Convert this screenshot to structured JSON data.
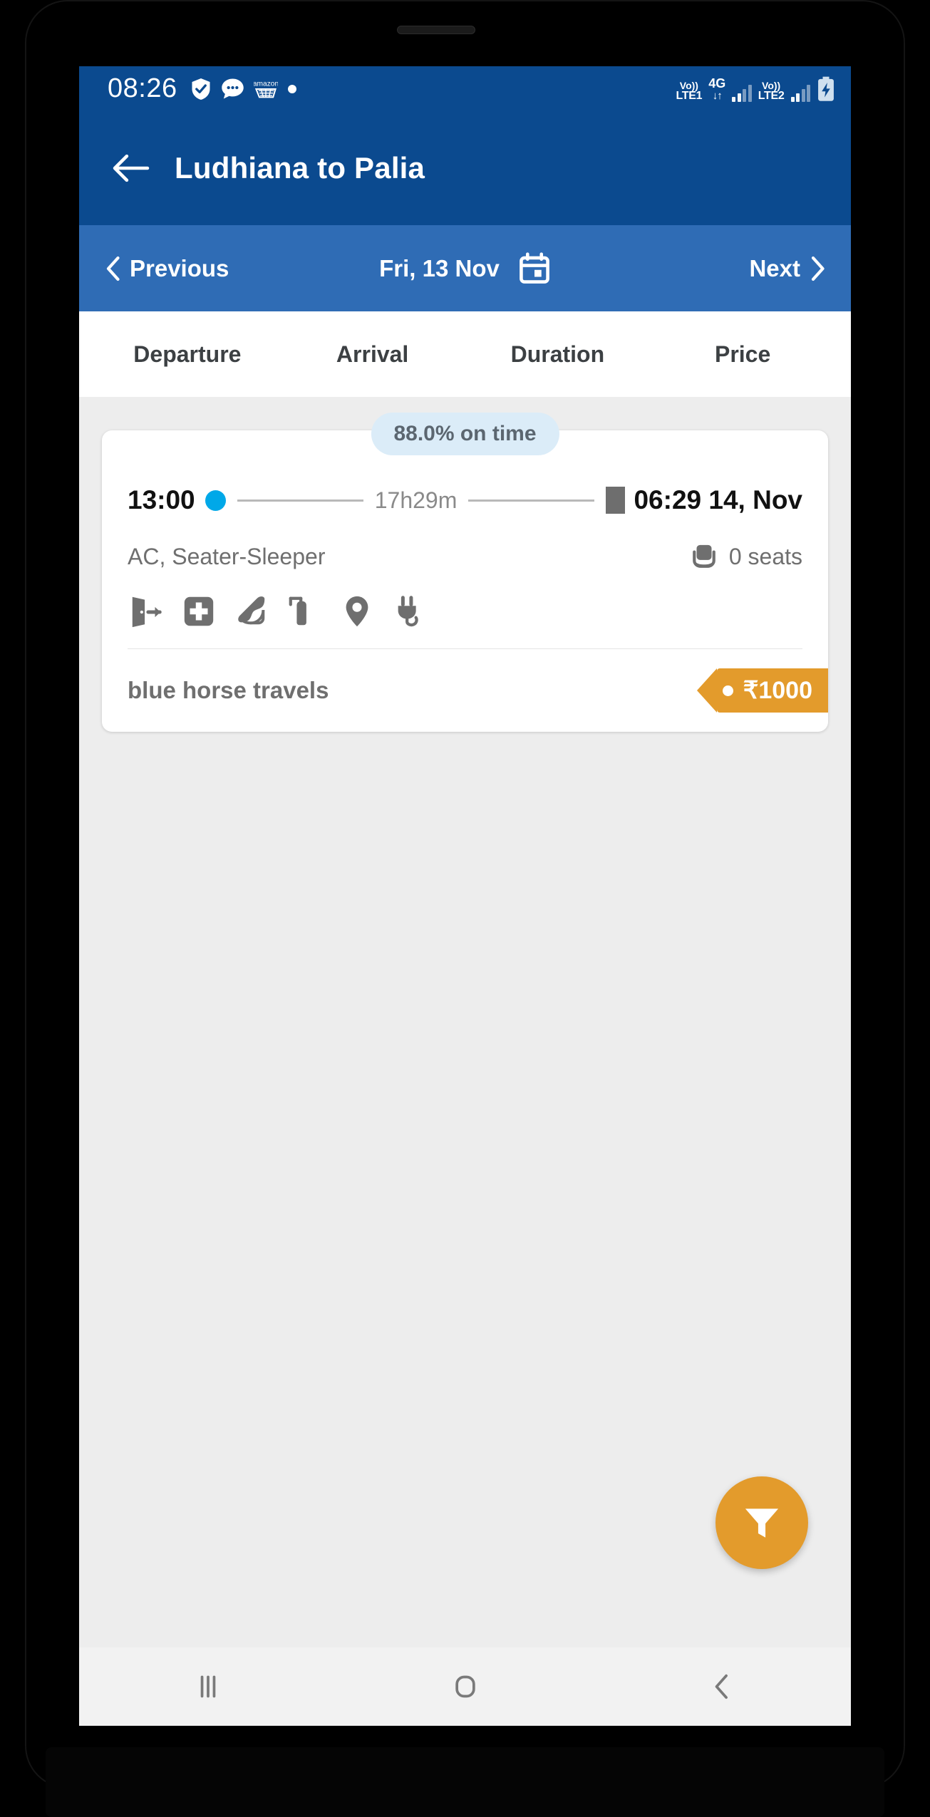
{
  "status_bar": {
    "clock": "08:26",
    "left_icons": [
      "shield-check-icon",
      "chat-bubble-icon",
      "amazon-cart-icon",
      "dot-icon"
    ],
    "network1_top": "Vo))",
    "network1_bottom": "LTE1",
    "data_type": "4G",
    "data_arrows": "↓↑",
    "network2_top": "Vo))",
    "network2_bottom": "LTE2",
    "battery": "charging-battery-icon"
  },
  "app_bar": {
    "back_icon": "back-arrow-icon",
    "title": "Ludhiana to Palia"
  },
  "date_nav": {
    "previous_label": "Previous",
    "date_label": "Fri, 13 Nov",
    "next_label": "Next",
    "calendar_icon": "calendar-icon"
  },
  "sort_tabs": [
    {
      "label": "Departure"
    },
    {
      "label": "Arrival"
    },
    {
      "label": "Duration"
    },
    {
      "label": "Price"
    }
  ],
  "bus_card": {
    "ontime_badge": "88.0% on time",
    "departure_time": "13:00",
    "duration": "17h29m",
    "arrival_time": "06:29 14, Nov",
    "bus_type": "AC, Seater-Sleeper",
    "seats_available": "0 seats",
    "amenities": [
      "emergency-exit-icon",
      "first-aid-kit-icon",
      "blanket-icon",
      "fire-extinguisher-icon",
      "live-tracking-pin-icon",
      "charging-point-icon"
    ],
    "operator_name": "blue horse travels",
    "price": "₹1000"
  },
  "filter_fab": {
    "icon": "filter-funnel-icon"
  },
  "nav_bar": {
    "recents_icon": "recents-icon",
    "home_icon": "home-icon",
    "back_icon": "back-chevron-icon"
  },
  "colors": {
    "app_bar_blue": "#0b4a8f",
    "date_nav_blue": "#2f6cb5",
    "accent_orange": "#e39b2c",
    "departure_dot_cyan": "#00a8e8",
    "badge_bg": "#dbecf8"
  }
}
